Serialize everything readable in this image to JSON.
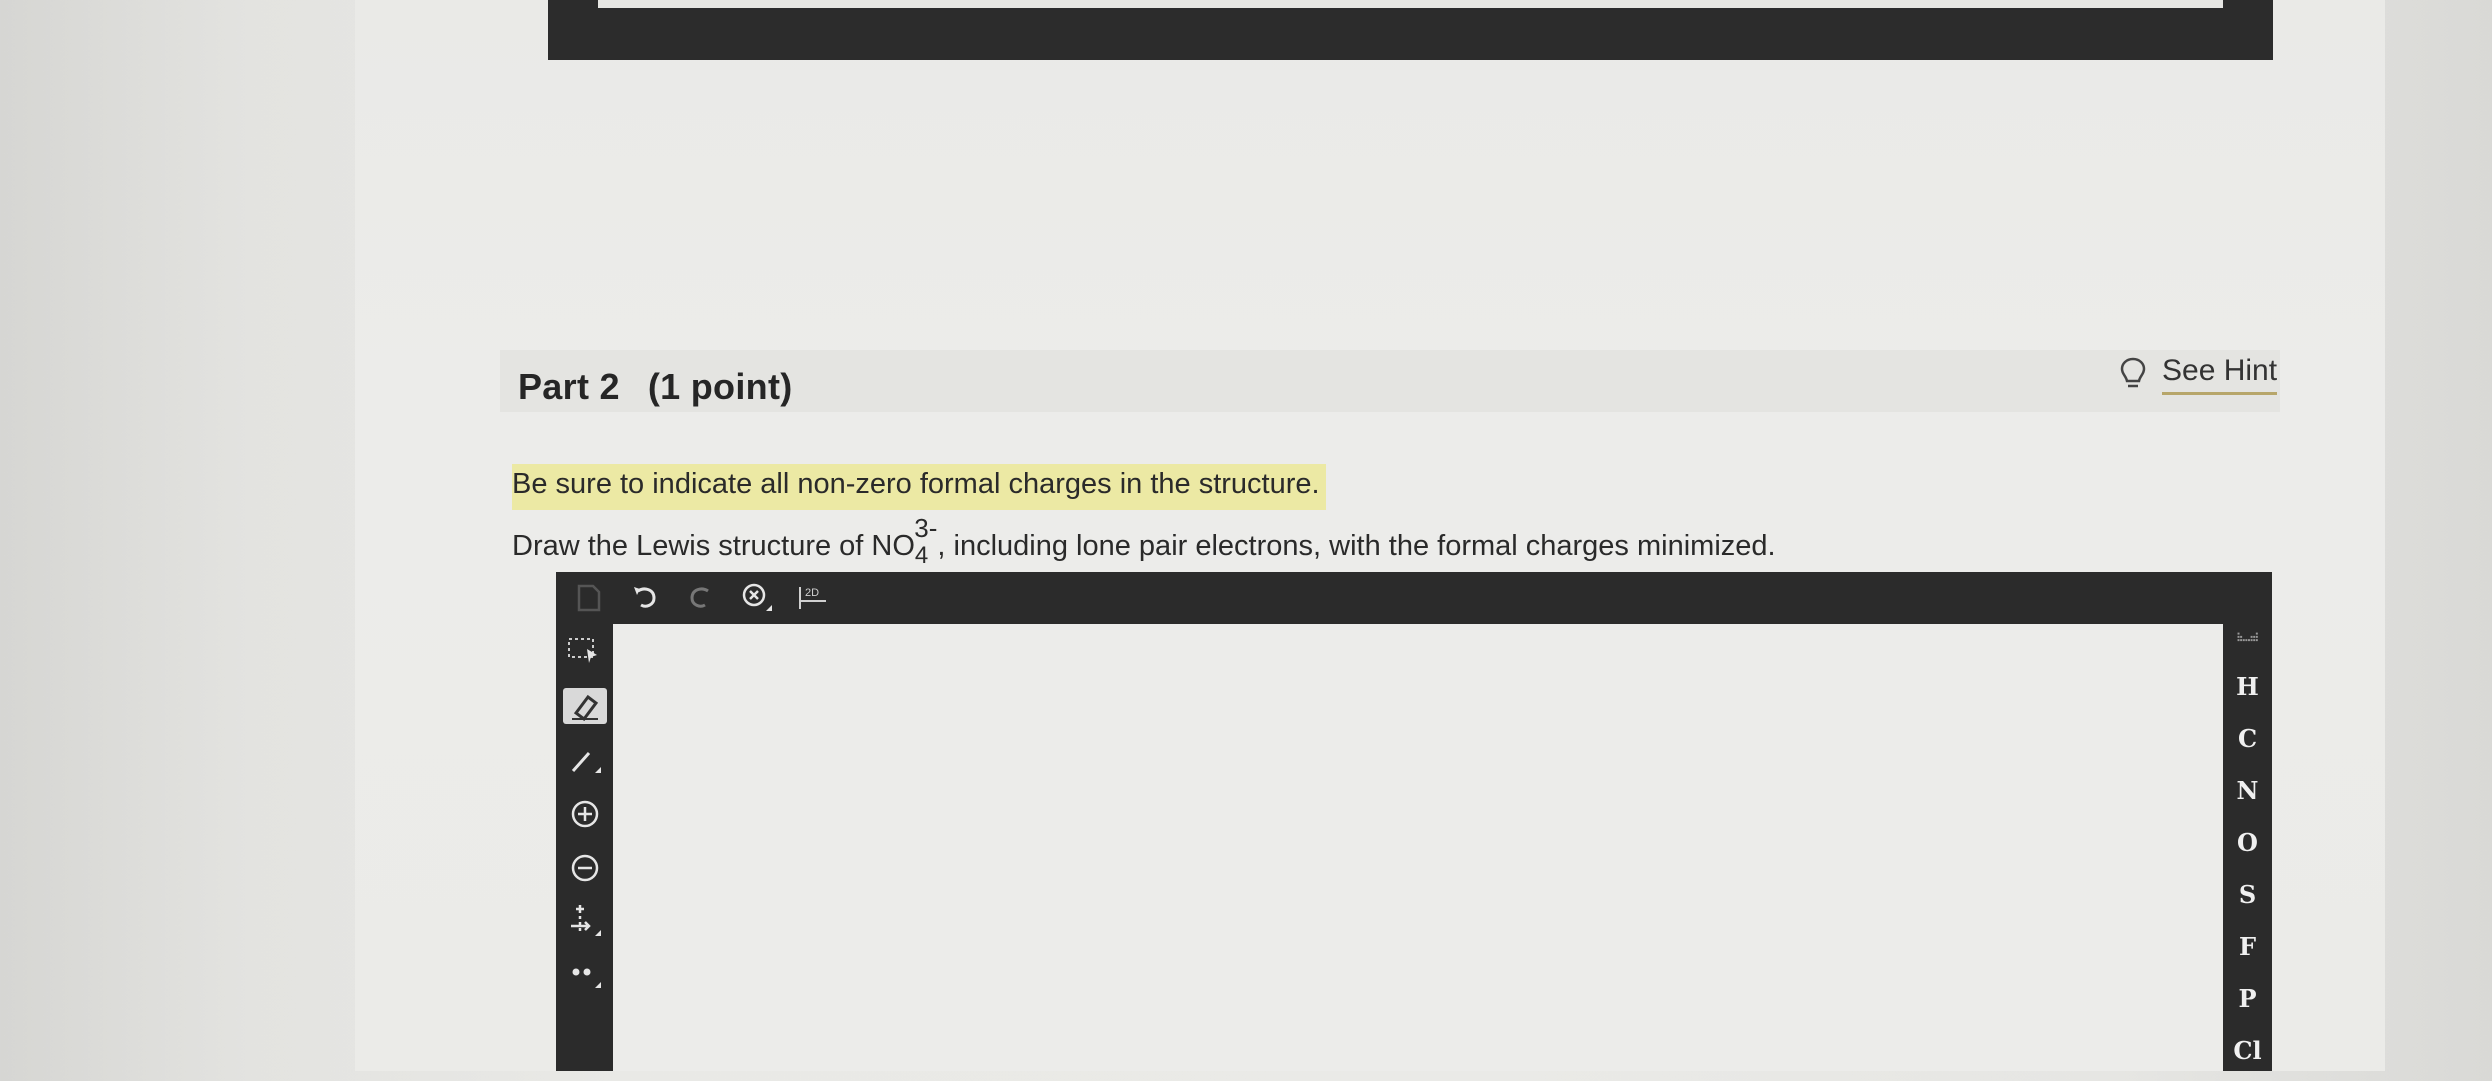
{
  "part": {
    "title": "Part 2",
    "points": "(1 point)"
  },
  "hint": {
    "icon": "lightbulb-icon",
    "label": "See Hint"
  },
  "instruction": "Be sure to indicate all non-zero formal charges in the structure.",
  "question": {
    "prefix": "Draw the Lewis structure of NO",
    "subscript": "4",
    "superscript": "3-",
    "suffix": ", including lone pair electrons, with the formal charges minimized."
  },
  "editor": {
    "top_tools": [
      "new-document-icon",
      "undo-icon",
      "redo-icon",
      "zoom-icon",
      "clean-2d-icon"
    ],
    "clean_label": "2D",
    "left_tools": [
      "select-icon",
      "eraser-icon",
      "bond-icon",
      "positive-charge-icon",
      "negative-charge-icon",
      "increase-charge-icon",
      "lone-pair-icon"
    ],
    "atoms": [
      "H",
      "C",
      "N",
      "O",
      "S",
      "F",
      "P",
      "Cl"
    ]
  },
  "colors": {
    "toolbar": "#2b2b2b",
    "highlight": "#ece9a4",
    "hint_underline": "#b7a66a"
  }
}
